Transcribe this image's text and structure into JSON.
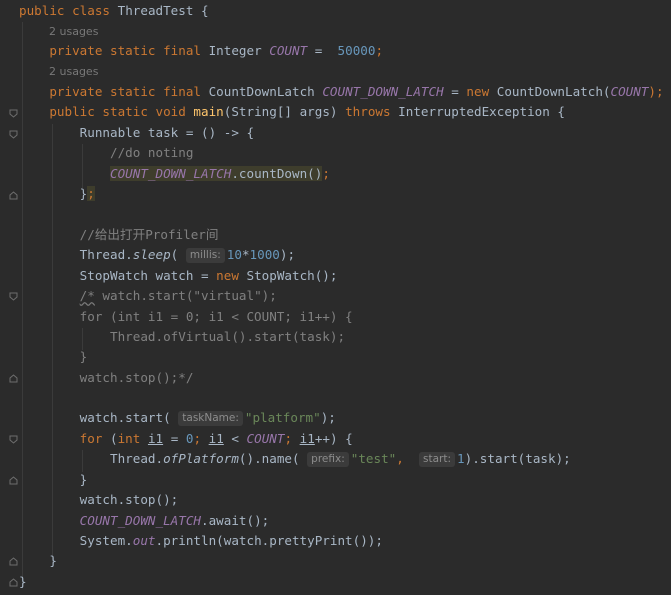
{
  "code": {
    "l1_kw1": "public",
    "l1_kw2": "class",
    "l1_name": "ThreadTest",
    "l1_brace": " {",
    "usages_1": "2 usages",
    "l3_kw": "private static final",
    "l3_type": "Integer",
    "l3_const": "COUNT",
    "l3_eq": " =  ",
    "l3_num": "50000",
    "l3_end": ";",
    "usages_2": "2 usages",
    "l5_kw": "private static final",
    "l5_type": "CountDownLatch",
    "l5_const": "COUNT_DOWN_LATCH",
    "l5_eq": " = ",
    "l5_new": "new",
    "l5_ctor": "CountDownLatch(",
    "l5_arg": "COUNT",
    "l5_end": ");",
    "l6_kw": "public static void",
    "l6_fn": "main",
    "l6_params": "(String[] args) ",
    "l6_throws": "throws",
    "l6_exc": " InterruptedException {",
    "l7": "Runnable task = () -> {",
    "l8_cmt": "//do noting",
    "l9_const": "COUNT_DOWN_LATCH",
    "l9_rest": ".countDown()",
    "l9_semi": ";",
    "l10_brace": "}",
    "l10_semi": ";",
    "l12_cmt": "//给出打开Profiler间",
    "l13_a": "Thread.",
    "l13_fn": "sleep",
    "l13_b": "(",
    "l13_hint": "millis:",
    "l13_num1": "10",
    "l13_op": "*",
    "l13_num2": "1000",
    "l13_end": ");",
    "l14_a": "StopWatch watch = ",
    "l14_new": "new",
    "l14_b": " StopWatch();",
    "l15_a": "/*",
    "l15_b": " watch.start(\"virtual\");",
    "l16": "for (int i1 = 0; i1 < COUNT; i1++) {",
    "l17": "Thread.ofVirtual().start(task);",
    "l18": "}",
    "l19": "watch.stop();*/",
    "l21_a": "watch.start(",
    "l21_hint": "taskName:",
    "l21_str": "\"platform\"",
    "l21_end": ");",
    "l22_for": "for",
    "l22_a": " (",
    "l22_int": "int",
    "l22_var1": "i1",
    "l22_b": " = ",
    "l22_n0": "0",
    "l22_c": "; ",
    "l22_var2": "i1",
    "l22_d": " < ",
    "l22_const": "COUNT",
    "l22_e": "; ",
    "l22_var3": "i1",
    "l22_f": "++) {",
    "l23_a": "Thread.",
    "l23_fn": "ofPlatform",
    "l23_b": "().name(",
    "l23_hint1": "prefix:",
    "l23_str": "\"test\"",
    "l23_c": ", ",
    "l23_hint2": "start:",
    "l23_num": "1",
    "l23_d": ").start(task);",
    "l24": "}",
    "l25": "watch.stop();",
    "l26_const": "COUNT_DOWN_LATCH",
    "l26_rest": ".await();",
    "l27_a": "System.",
    "l27_out": "out",
    "l27_b": ".println(watch.prettyPrint());",
    "l28": "}",
    "l29": "}"
  },
  "colors": {
    "background": "#2b2b2b",
    "keyword": "#cc7832",
    "constant": "#9876aa",
    "string": "#6a8759",
    "number": "#6897bb",
    "function": "#ffc66d",
    "comment": "#808080"
  }
}
